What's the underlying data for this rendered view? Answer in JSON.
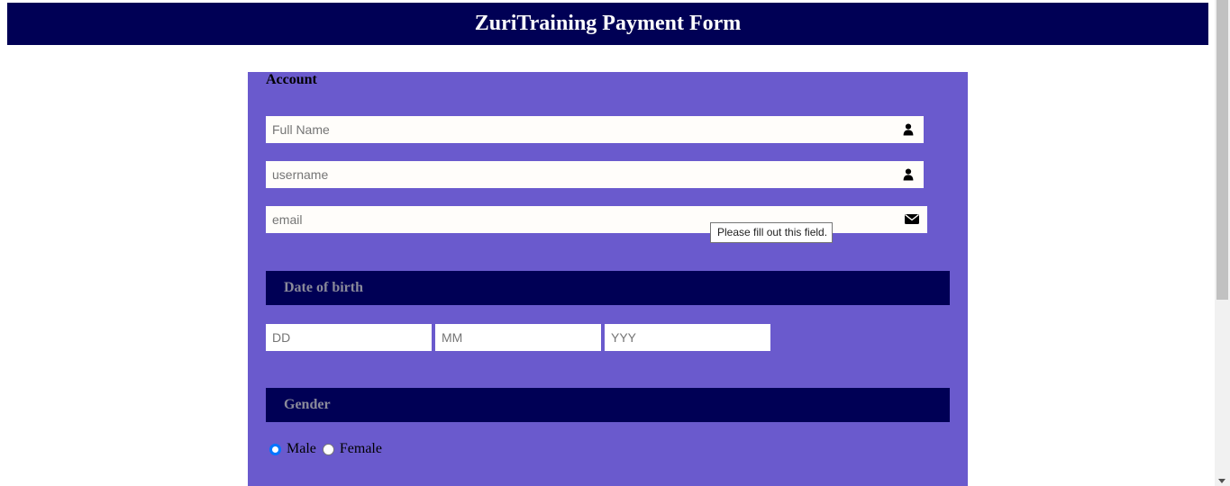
{
  "header": {
    "title": "ZuriTraining Payment Form"
  },
  "account": {
    "section_title": "Account",
    "full_name": {
      "placeholder": "Full Name",
      "value": "",
      "icon": "user-icon"
    },
    "username": {
      "placeholder": "username",
      "value": "",
      "icon": "user-icon"
    },
    "email": {
      "placeholder": "email",
      "value": "",
      "icon": "envelope-icon"
    },
    "validation_tooltip": "Please fill out this field."
  },
  "dob": {
    "title": "Date of birth",
    "day_placeholder": "DD",
    "month_placeholder": "MM",
    "year_placeholder": "YYY"
  },
  "gender": {
    "title": "Gender",
    "options": [
      {
        "label": "Male",
        "checked": true
      },
      {
        "label": "Female",
        "checked": false
      }
    ]
  },
  "colors": {
    "header_bg": "#000055",
    "panel_bg": "#6a5acd",
    "band_bg": "#000055",
    "radio_accent": "#0075ff"
  }
}
